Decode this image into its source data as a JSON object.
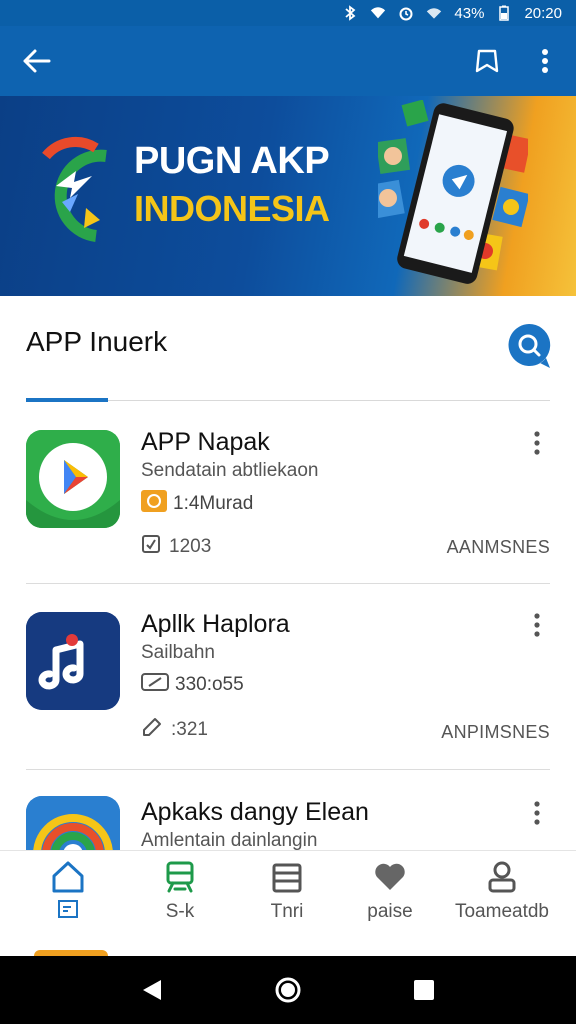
{
  "status_bar": {
    "battery": "43%",
    "time": "20:20",
    "icons": [
      "bluetooth-icon",
      "wifi-icon",
      "alarm-icon",
      "signal-icon",
      "battery-icon"
    ]
  },
  "app_bar": {
    "icons": [
      "back-arrow-icon",
      "bookmark-icon",
      "more-vert-icon"
    ]
  },
  "banner": {
    "title_line1": "PUGN AKP",
    "title_line2": "INDONESIA"
  },
  "section": {
    "title": "APP Inuerk",
    "search_icon": "search-chat-icon"
  },
  "apps": [
    {
      "name": "APP Napak",
      "subtitle": "Sendatain abtliekaon",
      "meta": "1:4Murad",
      "count": "1203",
      "tag": "AANMSNES",
      "icon": "play-store-icon"
    },
    {
      "name": "Apllk Haplora",
      "subtitle": "Sailbahn",
      "meta": "330:o55",
      "count": ":321",
      "tag": "ANPIMSNES",
      "icon": "music-note-icon"
    },
    {
      "name": "Apkaks dangy Elean",
      "subtitle": "Amlentain dainlangin",
      "icon": "rainbow-ring-icon"
    }
  ],
  "bottom_nav": [
    {
      "label": "",
      "icon": "home-icon"
    },
    {
      "label": "S-k",
      "icon": "tram-icon"
    },
    {
      "label": "Tnri",
      "icon": "calendar-icon"
    },
    {
      "label": "paise",
      "icon": "heart-icon"
    },
    {
      "label": "Toameatdb",
      "icon": "person-icon"
    }
  ],
  "colors": {
    "primary": "#0e63b0",
    "accent": "#1b74c4",
    "banner_yellow": "#f5c518",
    "nav_green": "#1e9a4a",
    "play_green": "#2fae4a"
  }
}
